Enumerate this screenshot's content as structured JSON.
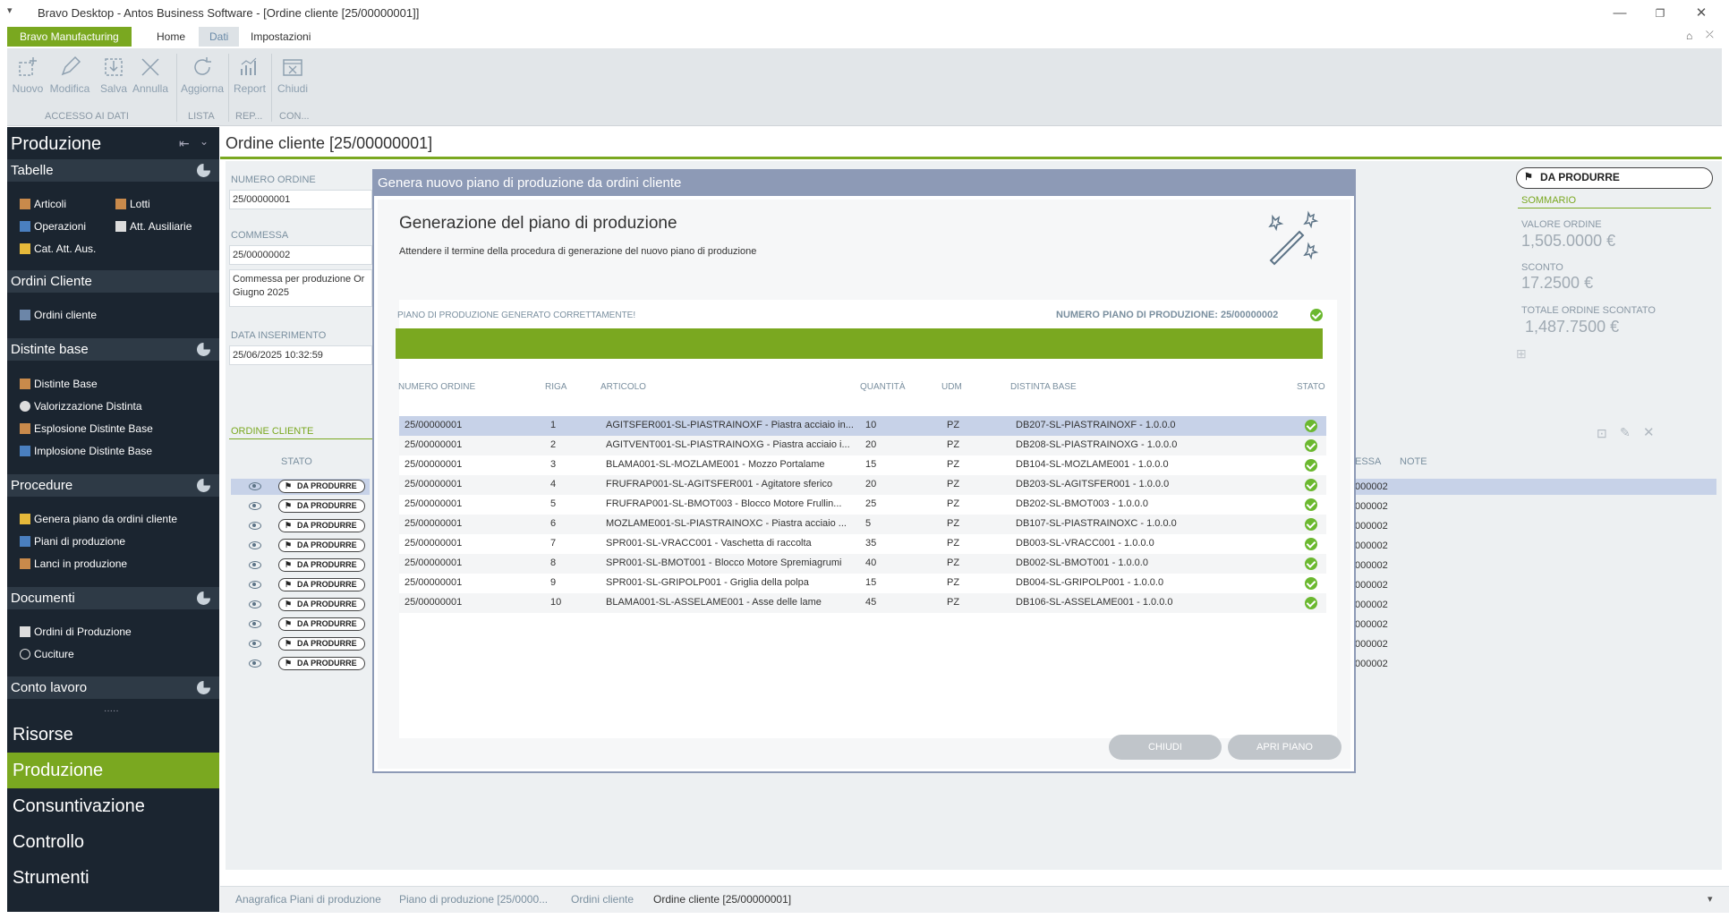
{
  "window": {
    "title": "Bravo Desktop - Antos Business Software - [Ordine cliente [25/00000001]]"
  },
  "ribbon_tabs": [
    "Bravo Manufacturing",
    "Home",
    "Dati",
    "Impostazioni"
  ],
  "ribbon": {
    "buttons": {
      "nuovo": "Nuovo",
      "modifica": "Modifica",
      "salva": "Salva",
      "annulla": "Annulla",
      "aggiorna": "Aggiorna",
      "report": "Report",
      "chiudi": "Chiudi"
    },
    "groups": {
      "accesso": "ACCESSO AI DATI",
      "lista": "LISTA",
      "rep": "REP...",
      "con": "CON..."
    }
  },
  "nav": {
    "title": "Produzione",
    "sections": {
      "tabelle": "Tabelle",
      "ordini_cliente": "Ordini Cliente",
      "distinte_base": "Distinte base",
      "procedure": "Procedure",
      "documenti": "Documenti",
      "conto_lavoro": "Conto lavoro"
    },
    "items": {
      "articoli": "Articoli",
      "lotti": "Lotti",
      "operazioni": "Operazioni",
      "att_ausiliarie": "Att. Ausiliarie",
      "cat_att_aus": "Cat. Att. Aus.",
      "ordini_cliente": "Ordini cliente",
      "distinte_base": "Distinte Base",
      "valorizzazione": "Valorizzazione Distinta",
      "esplosione": "Esplosione Distinte Base",
      "implosione": "Implosione Distinte Base",
      "genera_piano": "Genera piano da ordini cliente",
      "piani": "Piani di produzione",
      "lanci": "Lanci in produzione",
      "ordini_produzione": "Ordini di Produzione",
      "cuciture": "Cuciture"
    },
    "big_buttons": [
      "Risorse",
      "Produzione",
      "Consuntivazione",
      "Controllo",
      "Strumenti"
    ]
  },
  "page": {
    "title": "Ordine cliente [25/00000001]",
    "labels": {
      "numero_ordine": "NUMERO ORDINE",
      "commessa": "COMMESSA",
      "data_inserimento": "DATA INSERIMENTO",
      "ordine_cliente": "ORDINE CLIENTE",
      "stato": "STATO",
      "essa": "ESSA",
      "note": "NOTE"
    },
    "values": {
      "numero_ordine": "25/00000001",
      "commessa": "25/00000002",
      "commessa_desc_1": "Commessa per produzione Or",
      "commessa_desc_2": "Giugno 2025",
      "data_inserimento": "25/06/2025 10:32:59"
    },
    "status_button": "DA PRODURRE",
    "summary": {
      "title": "SOMMARIO",
      "valore_ordine_label": "VALORE ORDINE",
      "valore_ordine": "1,505.0000 €",
      "sconto_label": "SCONTO",
      "sconto": "17.2500 €",
      "totale_label": "TOTALE ORDINE SCONTATO",
      "totale": "1,487.7500 €"
    },
    "bg_rows": [
      {
        "stato": "DA PRODURRE",
        "commessa": "000002"
      },
      {
        "stato": "DA PRODURRE",
        "commessa": "000002"
      },
      {
        "stato": "DA PRODURRE",
        "commessa": "000002"
      },
      {
        "stato": "DA PRODURRE",
        "commessa": "000002"
      },
      {
        "stato": "DA PRODURRE",
        "commessa": "000002"
      },
      {
        "stato": "DA PRODURRE",
        "commessa": "000002"
      },
      {
        "stato": "DA PRODURRE",
        "commessa": "000002"
      },
      {
        "stato": "DA PRODURRE",
        "commessa": "000002"
      },
      {
        "stato": "DA PRODURRE",
        "commessa": "000002"
      },
      {
        "stato": "DA PRODURRE",
        "commessa": "000002"
      }
    ]
  },
  "modal": {
    "title": "Genera nuovo piano di produzione da ordini cliente",
    "heading": "Generazione del piano di produzione",
    "subtitle": "Attendere il termine della procedura di generazione del nuovo piano di produzione",
    "success_text": "PIANO DI PRODUZIONE GENERATO CORRETTAMENTE!",
    "numero_piano_text": "NUMERO PIANO DI PRODUZIONE: 25/00000002",
    "progress": 1.0,
    "columns": [
      "NUMERO ORDINE",
      "RIGA",
      "ARTICOLO",
      "QUANTITÀ",
      "UDM",
      "DISTINTA BASE",
      "STATO"
    ],
    "rows": [
      {
        "ordine": "25/00000001",
        "riga": "1",
        "articolo": "AGITSFER001-SL-PIASTRAINOXF - Piastra acciaio in...",
        "qta": "10",
        "udm": "PZ",
        "distinta": "DB207-SL-PIASTRAINOXF - 1.0.0.0"
      },
      {
        "ordine": "25/00000001",
        "riga": "2",
        "articolo": "AGITVENT001-SL-PIASTRAINOXG - Piastra acciaio i...",
        "qta": "20",
        "udm": "PZ",
        "distinta": "DB208-SL-PIASTRAINOXG - 1.0.0.0"
      },
      {
        "ordine": "25/00000001",
        "riga": "3",
        "articolo": "BLAMA001-SL-MOZLAME001 - Mozzo Portalame",
        "qta": "15",
        "udm": "PZ",
        "distinta": "DB104-SL-MOZLAME001 - 1.0.0.0"
      },
      {
        "ordine": "25/00000001",
        "riga": "4",
        "articolo": "FRUFRAP001-SL-AGITSFER001 - Agitatore sferico",
        "qta": "20",
        "udm": "PZ",
        "distinta": "DB203-SL-AGITSFER001 - 1.0.0.0"
      },
      {
        "ordine": "25/00000001",
        "riga": "5",
        "articolo": "FRUFRAP001-SL-BMOT003 - Blocco Motore Frullin...",
        "qta": "25",
        "udm": "PZ",
        "distinta": "DB202-SL-BMOT003 - 1.0.0.0"
      },
      {
        "ordine": "25/00000001",
        "riga": "6",
        "articolo": "MOZLAME001-SL-PIASTRAINOXC - Piastra acciaio ...",
        "qta": "5",
        "udm": "PZ",
        "distinta": "DB107-SL-PIASTRAINOXC - 1.0.0.0"
      },
      {
        "ordine": "25/00000001",
        "riga": "7",
        "articolo": "SPR001-SL-VRACC001 - Vaschetta di raccolta",
        "qta": "35",
        "udm": "PZ",
        "distinta": "DB003-SL-VRACC001 - 1.0.0.0"
      },
      {
        "ordine": "25/00000001",
        "riga": "8",
        "articolo": "SPR001-SL-BMOT001 - Blocco Motore Spremiagrumi",
        "qta": "40",
        "udm": "PZ",
        "distinta": "DB002-SL-BMOT001 - 1.0.0.0"
      },
      {
        "ordine": "25/00000001",
        "riga": "9",
        "articolo": "SPR001-SL-GRIPOLP001 - Griglia della polpa",
        "qta": "15",
        "udm": "PZ",
        "distinta": "DB004-SL-GRIPOLP001 - 1.0.0.0"
      },
      {
        "ordine": "25/00000001",
        "riga": "10",
        "articolo": "BLAMA001-SL-ASSELAME001 - Asse delle lame",
        "qta": "45",
        "udm": "PZ",
        "distinta": "DB106-SL-ASSELAME001 - 1.0.0.0"
      }
    ],
    "buttons": {
      "chiudi": "CHIUDI",
      "apri_piano": "APRI PIANO"
    }
  },
  "bottom_tabs": [
    "Anagrafica Piani di produzione",
    "Piano  di  produzione [25/0000...",
    "Ordini cliente",
    "Ordine cliente [25/00000001]"
  ],
  "colors": {
    "accent": "#7aa820",
    "nav_bg": "#1b2530",
    "modal_header": "#8d9ab6",
    "ok_green": "#6bb82f"
  }
}
